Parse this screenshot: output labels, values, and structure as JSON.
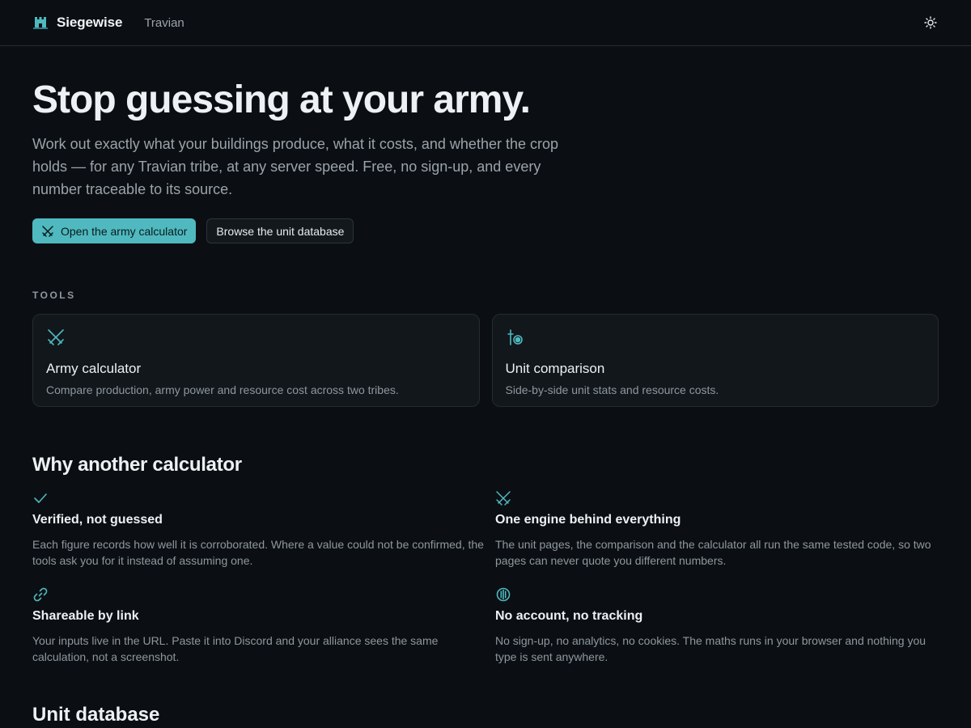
{
  "header": {
    "brand": "Siegewise",
    "game": "Travian",
    "brand_icon": "castle-icon",
    "theme_icon": "sun-icon"
  },
  "hero": {
    "title": "Stop guessing at your army.",
    "subtitle": "Work out exactly what your buildings produce, what it costs, and whether the crop holds — for any Travian tribe, at any server speed. Free, no sign-up, and every number traceable to its source.",
    "primary_label": "Open the army calculator",
    "primary_icon": "crossed-swords-icon",
    "secondary_label": "Browse the unit database"
  },
  "tools": {
    "eyebrow": "TOOLS",
    "items": [
      {
        "icon": "crossed-swords-icon",
        "title": "Army calculator",
        "desc": "Compare production, army power and resource cost across two tribes."
      },
      {
        "icon": "unit-compare-icon",
        "title": "Unit comparison",
        "desc": "Side-by-side unit stats and resource costs."
      }
    ]
  },
  "why": {
    "title": "Why another calculator",
    "items": [
      {
        "icon": "check-icon",
        "title": "Verified, not guessed",
        "desc": "Each figure records how well it is corroborated. Where a value could not be confirmed, the tools ask you for it instead of assuming one."
      },
      {
        "icon": "crossed-swords-icon",
        "title": "One engine behind everything",
        "desc": "The unit pages, the comparison and the calculator all run the same tested code, so two pages can never quote you different numbers."
      },
      {
        "icon": "link-icon",
        "title": "Shareable by link",
        "desc": "Your inputs live in the URL. Paste it into Discord and your alliance sees the same calculation, not a screenshot."
      },
      {
        "icon": "shield-icon",
        "title": "No account, no tracking",
        "desc": "No sign-up, no analytics, no cookies. The maths runs in your browser and nothing you type is sent anywhere."
      }
    ]
  },
  "next_section": {
    "title": "Unit database"
  },
  "colors": {
    "accent": "#4fb9bf",
    "background": "#0b0f13",
    "card": "#11171b",
    "muted": "#8e979f"
  }
}
